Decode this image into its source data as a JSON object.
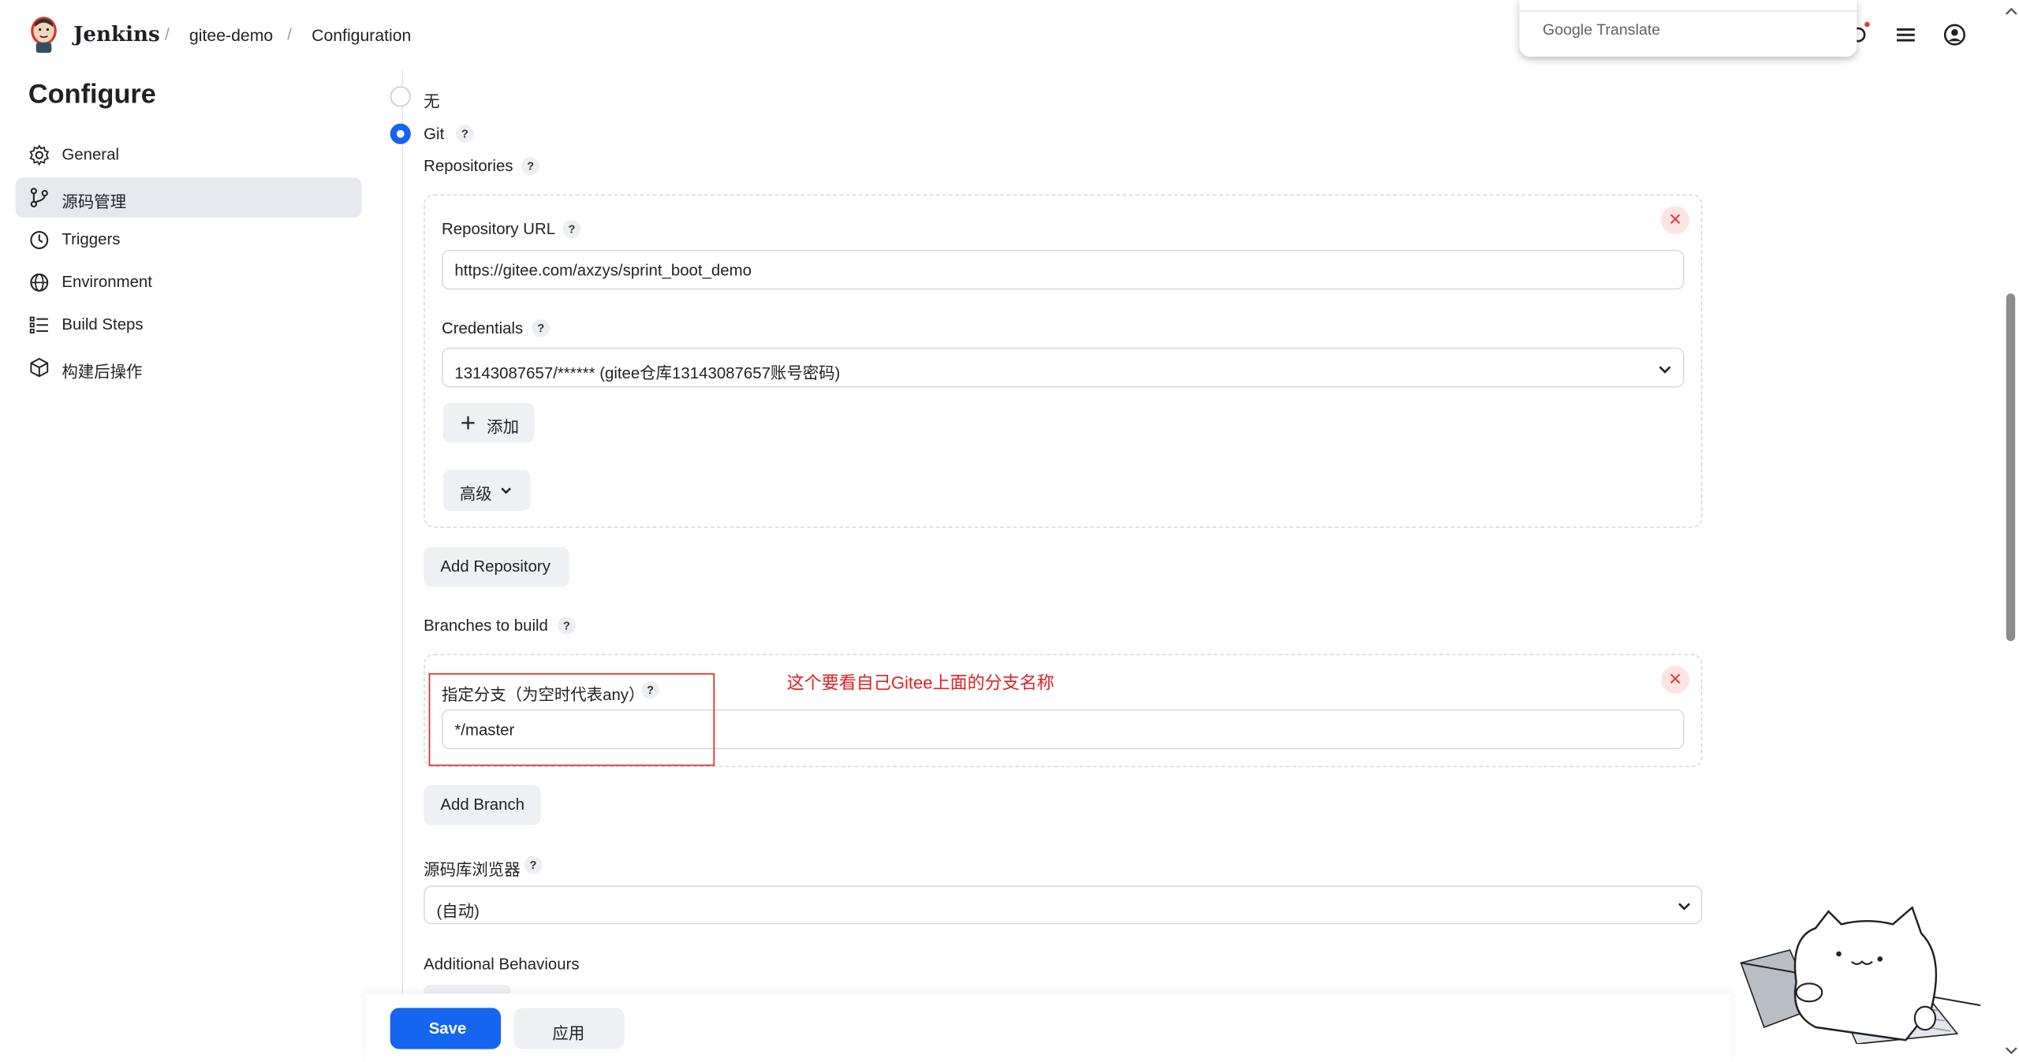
{
  "header": {
    "brand": "Jenkins",
    "breadcrumbs": [
      "gitee-demo",
      "Configuration"
    ],
    "separator": "/"
  },
  "translate_popup": {
    "label": "Google Translate"
  },
  "sidebar": {
    "title": "Configure",
    "items": [
      {
        "label": "General",
        "icon": "gear-icon",
        "active": false
      },
      {
        "label": "源码管理",
        "icon": "git-branch-icon",
        "active": true
      },
      {
        "label": "Triggers",
        "icon": "clock-icon",
        "active": false
      },
      {
        "label": "Environment",
        "icon": "globe-icon",
        "active": false
      },
      {
        "label": "Build Steps",
        "icon": "list-icon",
        "active": false
      },
      {
        "label": "构建后操作",
        "icon": "package-icon",
        "active": false
      }
    ]
  },
  "scm": {
    "none_label": "无",
    "git_label": "Git",
    "selected": "Git",
    "repositories_label": "Repositories",
    "repo_url_label": "Repository URL",
    "repo_url_value": "https://gitee.com/axzys/sprint_boot_demo",
    "credentials_label": "Credentials",
    "credentials_value": "13143087657/****** (gitee仓库13143087657账号密码)",
    "add_label": "添加",
    "advanced_label": "高级",
    "add_repository_label": "Add Repository",
    "branches_label": "Branches to build",
    "branch_specifier_label": "指定分支（为空时代表any）",
    "branch_value": "*/master",
    "add_branch_label": "Add Branch",
    "browser_label": "源码库浏览器",
    "browser_value": "(自动)",
    "additional_label": "Additional Behaviours",
    "annotation": "这个要看自己Gitee上面的分支名称"
  },
  "footer": {
    "save_label": "Save",
    "apply_label": "应用"
  },
  "help_glyph": "?",
  "remove_glyph": "✕",
  "colors": {
    "primary": "#1565f0",
    "annotation": "#e02020",
    "active_bg": "#e6e8ee"
  }
}
